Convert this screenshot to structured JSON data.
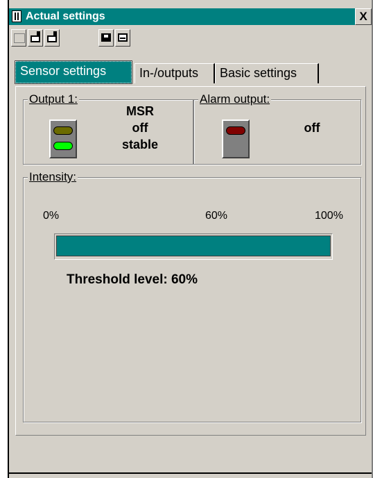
{
  "window": {
    "title": "Actual settings",
    "close_label": "X"
  },
  "toolbar": {
    "buttons": [
      {
        "icon": "new-icon"
      },
      {
        "icon": "import-icon"
      },
      {
        "icon": "export-icon"
      },
      {
        "icon": "save-icon"
      },
      {
        "icon": "print-icon"
      }
    ]
  },
  "tabs": [
    {
      "label": "Sensor settings",
      "active": true
    },
    {
      "label": "In-/outputs",
      "active": false
    },
    {
      "label": "Basic settings",
      "active": false
    }
  ],
  "output1": {
    "legend": "Output 1:",
    "line1": "MSR",
    "line2": "off",
    "line3": "stable",
    "led_top_color": "#6b6b00",
    "led_bottom_color": "#00ff00"
  },
  "alarm": {
    "legend": "Alarm output:",
    "status": "off",
    "led_color": "#800000"
  },
  "intensity": {
    "legend": "Intensity:",
    "scale_min": "0%",
    "scale_mid": "60%",
    "scale_max": "100%",
    "level_percent": 100,
    "threshold_text": "Threshold level: 60%"
  },
  "colors": {
    "accent": "#008080",
    "face": "#d4d0c8"
  }
}
